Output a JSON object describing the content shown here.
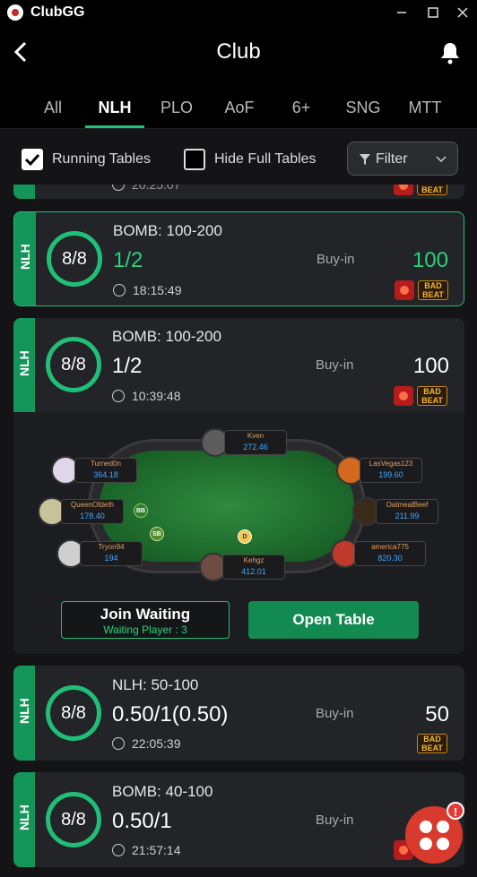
{
  "app": {
    "name": "ClubGG",
    "window_controls": [
      "minimize",
      "maximize",
      "close"
    ]
  },
  "header": {
    "title": "Club"
  },
  "tabs": [
    {
      "label": "All"
    },
    {
      "label": "NLH",
      "active": true
    },
    {
      "label": "PLO"
    },
    {
      "label": "AoF"
    },
    {
      "label": "6+"
    },
    {
      "label": "SNG"
    },
    {
      "label": "MTT"
    }
  ],
  "filters": {
    "running_tables": {
      "label": "Running Tables",
      "checked": true
    },
    "hide_full_tables": {
      "label": "Hide Full Tables",
      "checked": false
    },
    "filter_button": "Filter"
  },
  "partial_card": {
    "time": "20:25:07"
  },
  "tables": [
    {
      "game": "NLH",
      "seats": "8/8",
      "name": "BOMB: 100-200",
      "stakes": "1/2",
      "time": "18:15:49",
      "buyin_label": "Buy-in",
      "buyin": "100",
      "highlight": true
    },
    {
      "game": "NLH",
      "seats": "8/8",
      "name": "BOMB: 100-200",
      "stakes": "1/2",
      "time": "10:39:48",
      "buyin_label": "Buy-in",
      "buyin": "100"
    },
    {
      "game": "NLH",
      "seats": "8/8",
      "name": "NLH: 50-100",
      "stakes": "0.50/1(0.50)",
      "time": "22:05:39",
      "buyin_label": "Buy-in",
      "buyin": "50"
    },
    {
      "game": "NLH",
      "seats": "8/8",
      "name": "BOMB: 40-100",
      "stakes": "0.50/1",
      "time": "21:57:14",
      "buyin_label": "Buy-in",
      "buyin": ""
    }
  ],
  "badges": {
    "bad_beat_line1": "BAD",
    "bad_beat_line2": "BEAT"
  },
  "table_preview": {
    "players": [
      {
        "name": "Kven",
        "chips": "272.46"
      },
      {
        "name": "Turned0n",
        "chips": "364.18"
      },
      {
        "name": "LasVegas123",
        "chips": "199.60"
      },
      {
        "name": "QueenOfdeth",
        "chips": "178.40"
      },
      {
        "name": "OatmealBeef",
        "chips": "211.99"
      },
      {
        "name": "Tryon94",
        "chips": "194"
      },
      {
        "name": "america775",
        "chips": "820.30"
      },
      {
        "name": "Kehgz",
        "chips": "412.01"
      }
    ],
    "markers": {
      "bb": "BB",
      "sb": "SB",
      "dealer": "D"
    }
  },
  "actions": {
    "join_label": "Join Waiting",
    "join_sub": "Waiting Player : 3",
    "open_label": "Open Table"
  },
  "fab": {
    "badge": "!"
  }
}
